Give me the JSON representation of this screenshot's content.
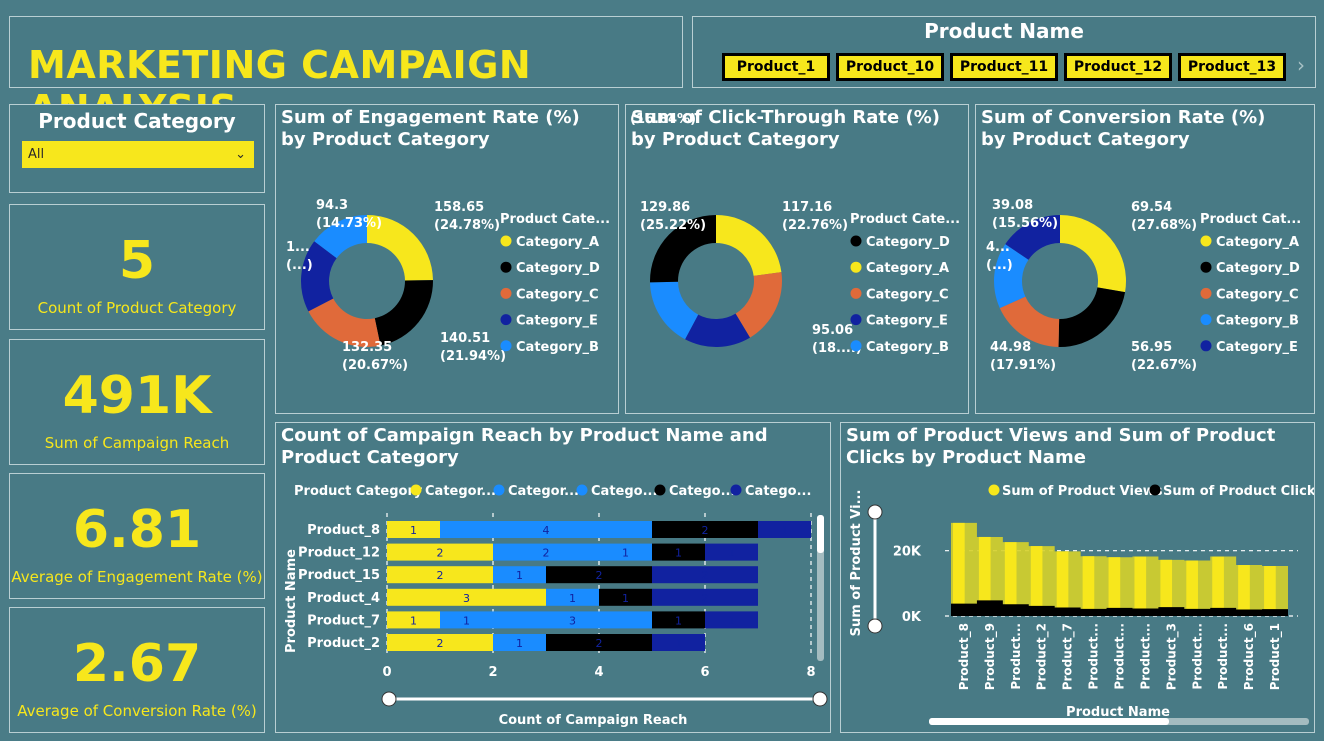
{
  "header": {
    "title": "MARKETING CAMPAIGN ANALYSIS"
  },
  "product_slicer": {
    "title": "Product Name",
    "items": [
      "Product_1",
      "Product_10",
      "Product_11",
      "Product_12",
      "Product_13"
    ]
  },
  "category_slicer": {
    "title": "Product Category",
    "selected": "All"
  },
  "cards": [
    {
      "value": "5",
      "label": "Count of Product Category"
    },
    {
      "value": "491K",
      "label": "Sum of Campaign Reach"
    },
    {
      "value": "6.81",
      "label": "Average of Engagement Rate (%)"
    },
    {
      "value": "2.67",
      "label": "Average of Conversion Rate (%)"
    }
  ],
  "colors": {
    "Category_A": "#f7e71c",
    "Category_D": "#000000",
    "Category_C": "#e06a3a",
    "Category_E": "#1122a0",
    "Category_B": "#1a8cff",
    "accent": "#f7e71c",
    "background": "#4a7c87"
  },
  "chart_data": [
    {
      "type": "pie",
      "title": "Sum of Engagement Rate (%) by Product Category",
      "legend_title": "Product Cate...",
      "slices": [
        {
          "name": "Category_A",
          "value": 158.65,
          "pct": "24.78%",
          "label": "158.65",
          "label2": "(24.78%)"
        },
        {
          "name": "Category_D",
          "value": 140.51,
          "pct": "21.94%",
          "label": "140.51",
          "label2": "(21.94%)"
        },
        {
          "name": "Category_C",
          "value": 132.35,
          "pct": "20.67%",
          "label": "132.35",
          "label2": "(20.67%)"
        },
        {
          "name": "Category_E",
          "value": 114.5,
          "pct": "17.88%",
          "label": "1...",
          "label2": "(...)"
        },
        {
          "name": "Category_B",
          "value": 94.3,
          "pct": "14.73%",
          "label": "94.3",
          "label2": "(14.73%)"
        }
      ]
    },
    {
      "type": "pie",
      "title": "Sum of Click-Through Rate (%) by Product Category",
      "legend_title": "Product Cate...",
      "slices": [
        {
          "name": "Category_A",
          "value": 117.16,
          "pct": "22.76%",
          "label": "117.16",
          "label2": "(22.76%)"
        },
        {
          "name": "Category_C",
          "value": 95.06,
          "pct": "18.47%",
          "label": "95.06",
          "label2": "(18....)"
        },
        {
          "name": "Category_E",
          "value": 84.0,
          "pct": "16.32%",
          "label": "",
          "label2": ""
        },
        {
          "name": "Category_B",
          "value": 86.7,
          "pct": "16.84%",
          "label": "86.7",
          "label2": "(16.84%)"
        },
        {
          "name": "Category_D",
          "value": 129.86,
          "pct": "25.22%",
          "label": "129.86",
          "label2": "(25.22%)"
        }
      ],
      "legend_order": [
        "Category_D",
        "Category_A",
        "Category_C",
        "Category_E",
        "Category_B"
      ]
    },
    {
      "type": "pie",
      "title": "Sum of Conversion Rate (%) by Product Category",
      "legend_title": "Product Cat...",
      "slices": [
        {
          "name": "Category_A",
          "value": 69.54,
          "pct": "27.68%",
          "label": "69.54",
          "label2": "(27.68%)"
        },
        {
          "name": "Category_D",
          "value": 56.95,
          "pct": "22.67%",
          "label": "56.95",
          "label2": "(22.67%)"
        },
        {
          "name": "Category_C",
          "value": 44.98,
          "pct": "17.91%",
          "label": "44.98",
          "label2": "(17.91%)"
        },
        {
          "name": "Category_B",
          "value": 40.64,
          "pct": "16.18%",
          "label": "4...",
          "label2": "(...)"
        },
        {
          "name": "Category_E",
          "value": 39.08,
          "pct": "15.56%",
          "label": "39.08",
          "label2": "(15.56%)"
        }
      ]
    },
    {
      "type": "bar",
      "orientation": "horizontal",
      "stacked": true,
      "title": "Count of Campaign Reach by Product Name and Product Category",
      "xlabel": "Count of Campaign Reach",
      "ylabel": "Product Name",
      "legend_title": "Product Category",
      "legend": [
        "Categor...",
        "Categor...",
        "Catego...",
        "Catego...",
        "Catego..."
      ],
      "legend_keys": [
        "Category_A",
        "Category_B",
        "Category_B",
        "Category_D",
        "Category_E"
      ],
      "xlim": [
        0,
        8
      ],
      "xticks": [
        0,
        2,
        4,
        6,
        8
      ],
      "categories": [
        "Product_8",
        "Product_12",
        "Product_15",
        "Product_4",
        "Product_7",
        "Product_2"
      ],
      "rows": [
        [
          [
            "Category_A",
            1
          ],
          [
            "Category_B",
            4
          ],
          [
            "Category_D",
            2
          ],
          [
            "Category_E",
            1
          ]
        ],
        [
          [
            "Category_A",
            2
          ],
          [
            "Category_B",
            2
          ],
          [
            "Category_B",
            1
          ],
          [
            "Category_D",
            1
          ],
          [
            "Category_E",
            1
          ]
        ],
        [
          [
            "Category_A",
            2
          ],
          [
            "Category_B",
            1
          ],
          [
            "Category_D",
            2
          ],
          [
            "Category_E",
            2
          ]
        ],
        [
          [
            "Category_A",
            3
          ],
          [
            "Category_B",
            1
          ],
          [
            "Category_D",
            1
          ],
          [
            "Category_E",
            2
          ]
        ],
        [
          [
            "Category_A",
            1
          ],
          [
            "Category_B",
            1
          ],
          [
            "Category_B",
            3
          ],
          [
            "Category_D",
            1
          ],
          [
            "Category_E",
            1
          ]
        ],
        [
          [
            "Category_A",
            2
          ],
          [
            "Category_B",
            1
          ],
          [
            "Category_D",
            2
          ],
          [
            "Category_E",
            1
          ]
        ]
      ]
    },
    {
      "type": "area",
      "title": "Sum of Product Views and Sum of Product Clicks by Product Name",
      "xlabel": "Product Name",
      "ylabel": "Sum of Product Vi...",
      "yticks": [
        "20K",
        "0K"
      ],
      "ylim": [
        0,
        30000
      ],
      "categories": [
        "Product_8",
        "Product_9",
        "Product...",
        "Product_2",
        "Product_7",
        "Product...",
        "Product...",
        "Product...",
        "Product_3",
        "Product...",
        "Product...",
        "Product_6",
        "Product_1"
      ],
      "series": [
        {
          "name": "Sum of Product Views",
          "values": [
            28500,
            24200,
            22600,
            21400,
            19800,
            18300,
            18000,
            18200,
            17200,
            17000,
            18200,
            15600,
            15300
          ]
        },
        {
          "name": "Sum of Product Clicks",
          "values": [
            3800,
            4800,
            3600,
            3100,
            2600,
            2200,
            2500,
            2300,
            2700,
            2200,
            2500,
            2000,
            2100
          ]
        }
      ]
    }
  ]
}
